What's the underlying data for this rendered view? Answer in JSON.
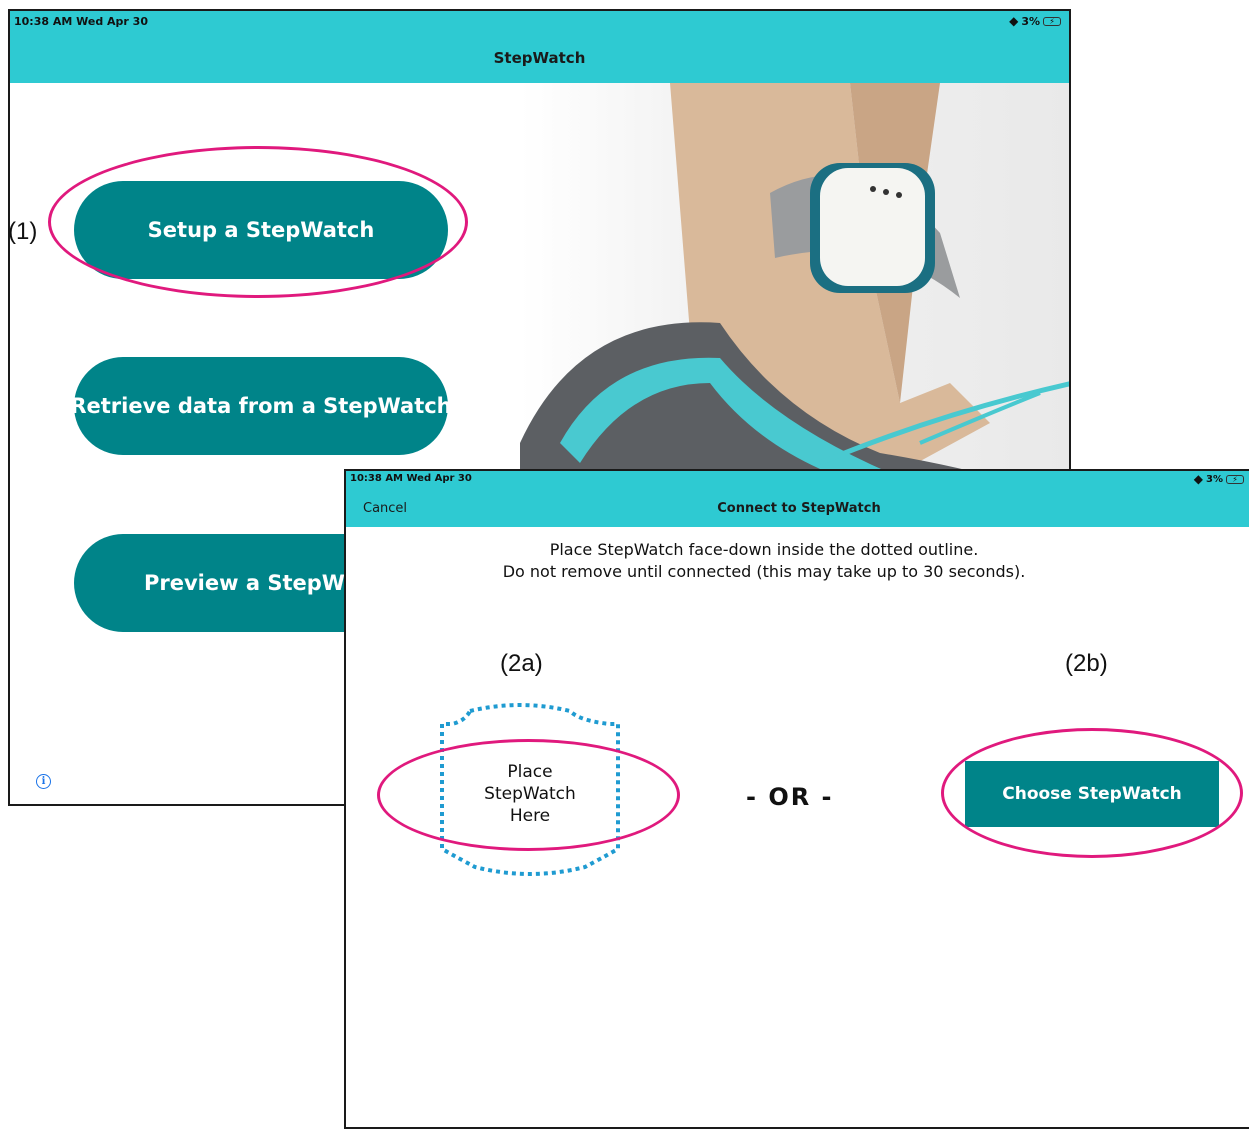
{
  "screen1": {
    "status": {
      "time": "10:38 AM  Wed Apr 30",
      "battery": "3%"
    },
    "title": "StepWatch",
    "buttons": {
      "setup": "Setup a StepWatch",
      "retrieve": "Retrieve data from a StepWatch",
      "preview": "Preview a StepWatch"
    }
  },
  "screen2": {
    "status": {
      "time": "10:38 AM  Wed Apr 30",
      "battery": "3%"
    },
    "cancel": "Cancel",
    "title": "Connect to StepWatch",
    "instructions_line1": "Place StepWatch face-down inside the dotted outline.",
    "instructions_line2": "Do not remove until connected (this may take up to 30 seconds).",
    "placeholder": [
      "Place",
      "StepWatch",
      "Here"
    ],
    "or": "- OR -",
    "choose": "Choose StepWatch"
  },
  "annotations": {
    "a1": "(1)",
    "a2a": "(2a)",
    "a2b": "(2b)"
  },
  "colors": {
    "navbar": "#2ecad2",
    "button": "#008489",
    "highlight": "#e0197d",
    "outline": "#1f9bd1"
  }
}
